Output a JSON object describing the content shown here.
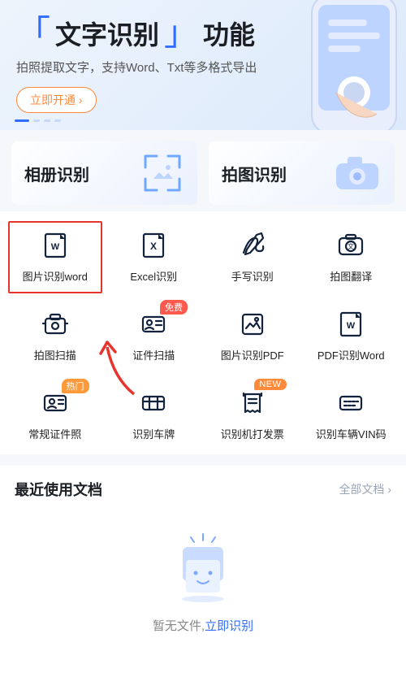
{
  "hero": {
    "feature": "文字识别",
    "feature_suffix": "功能",
    "subtitle": "拍照提取文字，支持Word、Txt等多格式导出",
    "cta": "立即开通 ›"
  },
  "modes": {
    "album": "相册识别",
    "camera": "拍图识别"
  },
  "grid": [
    {
      "id": "img-word",
      "label": "图片识别word",
      "highlight": true
    },
    {
      "id": "excel",
      "label": "Excel识别"
    },
    {
      "id": "handwrite",
      "label": "手写识别"
    },
    {
      "id": "translate",
      "label": "拍图翻译"
    },
    {
      "id": "scan",
      "label": "拍图扫描"
    },
    {
      "id": "idscan",
      "label": "证件扫描",
      "badge": {
        "text": "免费",
        "cls": "free"
      }
    },
    {
      "id": "img-pdf",
      "label": "图片识别PDF"
    },
    {
      "id": "pdf-word",
      "label": "PDF识别Word"
    },
    {
      "id": "idphoto",
      "label": "常规证件照",
      "badge": {
        "text": "热门",
        "cls": "hot"
      }
    },
    {
      "id": "plate",
      "label": "识别车牌"
    },
    {
      "id": "receipt",
      "label": "识别机打发票",
      "badge": {
        "text": "NEW",
        "cls": "new"
      }
    },
    {
      "id": "vin",
      "label": "识别车辆VIN码"
    }
  ],
  "recent": {
    "title": "最近使用文档",
    "all": "全部文档 ›",
    "empty_prefix": "暂无文件,",
    "empty_link": "立即识别"
  }
}
